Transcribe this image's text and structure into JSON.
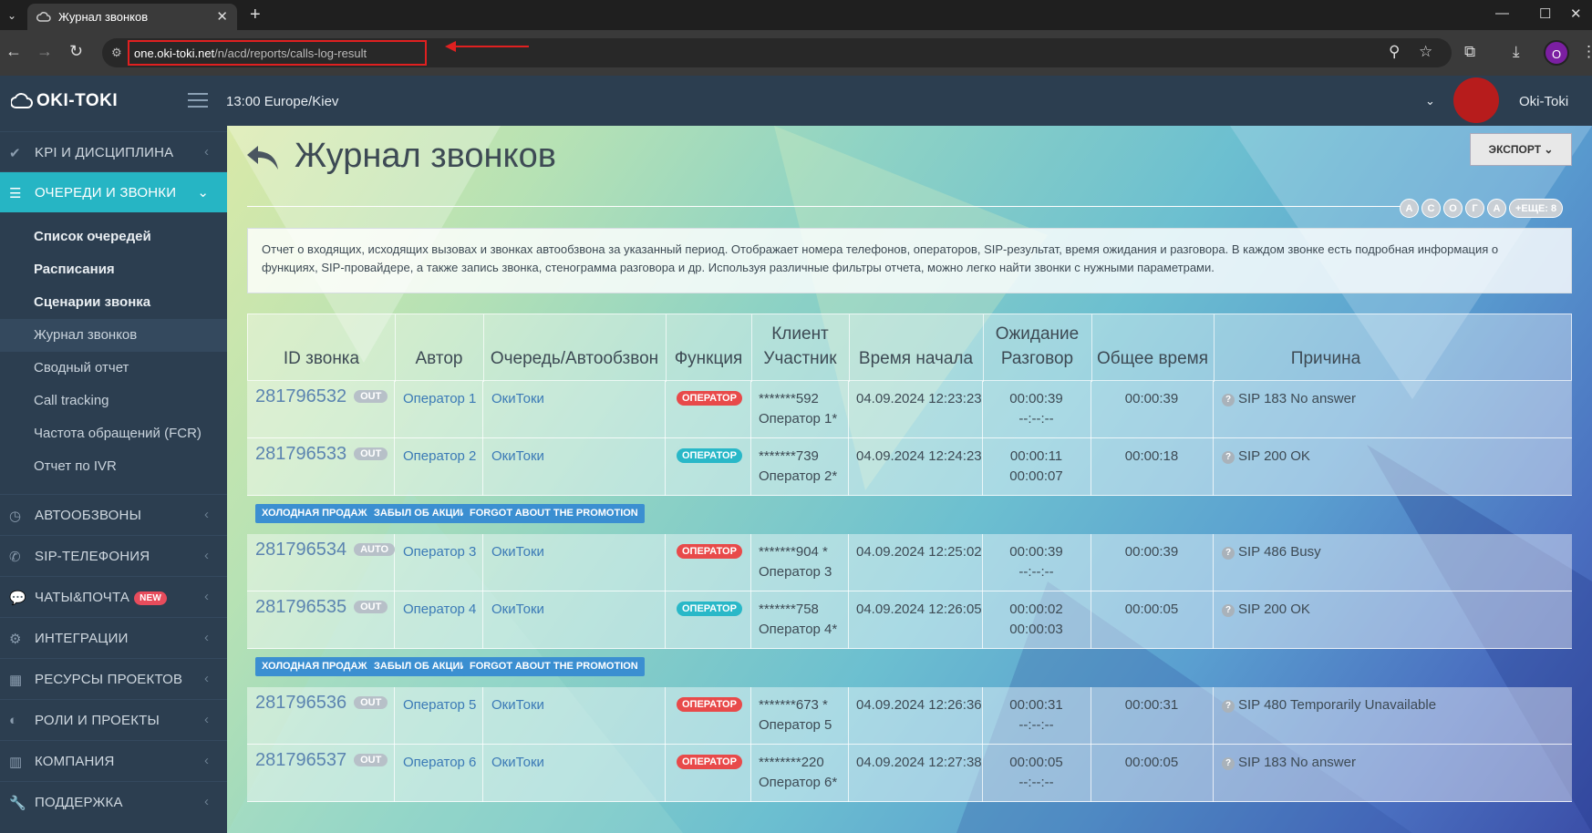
{
  "browser": {
    "tab_title": "Журнал звонков",
    "url_domain": "one.oki-toki.net",
    "url_path": "/n/acd/reports/calls-log-result",
    "profile_letter": "O"
  },
  "header": {
    "logo": "OKI-TOKI",
    "time": "13:00  Europe/Kiev",
    "user": "Oki-Toki"
  },
  "sidebar": {
    "items": [
      {
        "label": "KPI И ДИСЦИПЛИНА",
        "icon": "check-icon"
      },
      {
        "label": "ОЧЕРЕДИ И ЗВОНКИ",
        "icon": "list-icon"
      },
      {
        "label": "АВТООБЗВОНЫ",
        "icon": "clock-icon"
      },
      {
        "label": "SIP-ТЕЛЕФОНИЯ",
        "icon": "phone-icon"
      },
      {
        "label": "ЧАТЫ&ПОЧТА",
        "icon": "chat-icon",
        "badge": "NEW"
      },
      {
        "label": "ИНТЕГРАЦИИ",
        "icon": "cogs-icon"
      },
      {
        "label": "РЕСУРСЫ ПРОЕКТОВ",
        "icon": "grid-icon"
      },
      {
        "label": "РОЛИ И ПРОЕКТЫ",
        "icon": "toggle-icon"
      },
      {
        "label": "КОМПАНИЯ",
        "icon": "bar-chart-icon"
      },
      {
        "label": "ПОДДЕРЖКА",
        "icon": "wrench-icon"
      }
    ],
    "subitems": [
      "Список очередей",
      "Расписания",
      "Сценарии звонка",
      "Журнал звонков",
      "Сводный отчет",
      "Call tracking",
      "Частота обращений (FCR)",
      "Отчет по IVR"
    ]
  },
  "main": {
    "title": "Журнал звонков",
    "export_label": "ЭКСПОРТ",
    "chips": [
      "А",
      "С",
      "О",
      "Г",
      "А"
    ],
    "chips_more": "+ЕЩЕ: 8",
    "description": "Отчет о входящих, исходящих вызовах и звонках автообзвона за указанный период. Отображает номера телефонов, операторов, SIP-результат, время ожидания и разговора. В каждом звонке есть подробная информация о функциях, SIP-провайдере, а также запись звонка, стенограмма разговора и др. Используя различные фильтры отчета, можно легко найти звонки с нужными параметрами."
  },
  "table": {
    "headers": {
      "id": "ID звонка",
      "author": "Автор",
      "queue": "Очередь/Автообзвон",
      "function": "Функция",
      "client_1": "Клиент",
      "client_2": "Участник",
      "start": "Время начала",
      "wait_1": "Ожидание",
      "wait_2": "Разговор",
      "total": "Общее время",
      "reason": "Причина"
    },
    "tags": [
      "ХОЛОДНАЯ ПРОДАЖА",
      "ЗАБЫЛ ОБ АКЦИИ",
      "FORGOT ABOUT THE PROMOTION"
    ],
    "rows": [
      {
        "id": "281796532",
        "dir": "OUT",
        "author": "Оператор 1",
        "queue": "ОкиТоки",
        "func": "ОПЕРАТОР",
        "client": "*******592",
        "participant": "Оператор 1*",
        "start": "04.09.2024 12:23:23",
        "wait": "00:00:39",
        "talk": "--:--:--",
        "total": "00:00:39",
        "reason": "SIP 183 No answer"
      },
      {
        "id": "281796533",
        "dir": "OUT",
        "author": "Оператор 2",
        "queue": "ОкиТоки",
        "func": "ОПЕРАТОР",
        "client": "*******739",
        "participant": "Оператор 2*",
        "start": "04.09.2024 12:24:23",
        "wait": "00:00:11",
        "talk": "00:00:07",
        "total": "00:00:18",
        "reason": "SIP 200 OK"
      },
      {
        "id": "281796534",
        "dir": "AUTO",
        "author": "Оператор 3",
        "queue": "ОкиТоки",
        "func": "ОПЕРАТОР",
        "client": "*******904 *",
        "participant": "Оператор 3",
        "start": "04.09.2024 12:25:02",
        "wait": "00:00:39",
        "talk": "--:--:--",
        "total": "00:00:39",
        "reason": "SIP 486 Busy"
      },
      {
        "id": "281796535",
        "dir": "OUT",
        "author": "Оператор 4",
        "queue": "ОкиТоки",
        "func": "ОПЕРАТОР",
        "client": "*******758",
        "participant": "Оператор 4*",
        "start": "04.09.2024 12:26:05",
        "wait": "00:00:02",
        "talk": "00:00:03",
        "total": "00:00:05",
        "reason": "SIP 200 OK"
      },
      {
        "id": "281796536",
        "dir": "OUT",
        "author": "Оператор 5",
        "queue": "ОкиТоки",
        "func": "ОПЕРАТОР",
        "client": "*******673 *",
        "participant": "Оператор 5",
        "start": "04.09.2024 12:26:36",
        "wait": "00:00:31",
        "talk": "--:--:--",
        "total": "00:00:31",
        "reason": "SIP 480 Temporarily Unavailable"
      },
      {
        "id": "281796537",
        "dir": "OUT",
        "author": "Оператор 6",
        "queue": "ОкиТоки",
        "func": "ОПЕРАТОР",
        "client": "********220",
        "participant": "Оператор 6*",
        "start": "04.09.2024 12:27:38",
        "wait": "00:00:05",
        "talk": "--:--:--",
        "total": "00:00:05",
        "reason": "SIP 183 No answer"
      }
    ]
  },
  "colors": {
    "sidebar_bg": "#2c3e50",
    "accent_cyan": "#26b5c4",
    "func_red": "#e84a4a",
    "func_cyan": "#29b8c8",
    "tag_blue": "#3b8fd1",
    "annotation_red": "#e02020"
  }
}
